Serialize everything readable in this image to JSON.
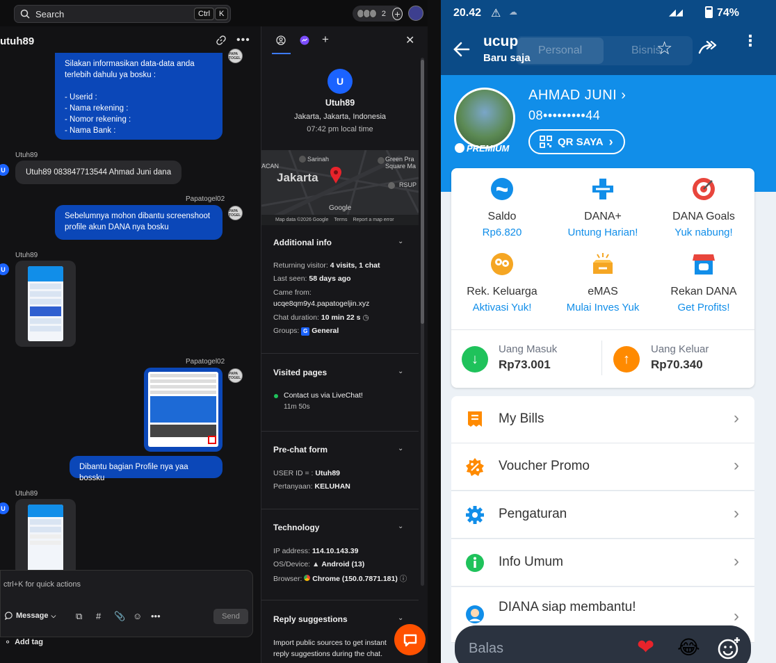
{
  "livechat": {
    "search": {
      "placeholder": "Search",
      "kbd1": "Ctrl",
      "kbd2": "K"
    },
    "top_count": "2",
    "chat_title": "utuh89",
    "messages": {
      "agent_msg1_lines": [
        "Silakan informasikan data-data anda",
        "terlebih dahulu ya bosku :",
        "",
        "- Userid :",
        "- Nama rekening :",
        "- Nomor rekening :",
        "- Nama Bank :"
      ],
      "cust_name": "Utuh89",
      "cust_msg1": "Utuh89 083847713544 Ahmad Juni dana",
      "agent_name": "Papatogel02",
      "agent_msg2": "Sebelumnya mohon dibantu screenshoot profile akun DANA nya bosku",
      "agent_msg3": "Dibantu bagian Profile nya yaa bossku",
      "avatar_letter": "U",
      "agent_avatar_text": "PAPA TOGEL"
    },
    "composer": {
      "placeholder": "ctrl+K for quick actions",
      "mode": "Message",
      "send": "Send",
      "add_tag": "Add tag"
    },
    "details": {
      "avatar_letter": "U",
      "name": "Utuh89",
      "location": "Jakarta, Jakarta, Indonesia",
      "local_time": "07:42 pm local time",
      "map": {
        "city": "Jakarta",
        "sarinah": "Sarinah",
        "acan": "ACAN",
        "green": "Green Pra",
        "green2": "Square Ma",
        "rsup": "RSUP",
        "google": "Google",
        "footer_data": "Map data ©2026 Google",
        "footer_terms": "Terms",
        "footer_report": "Report a map error"
      },
      "additional_title": "Additional info",
      "returning_label": "Returning visitor:",
      "returning_value": "4 visits, 1 chat",
      "last_seen_label": "Last seen:",
      "last_seen_value": "58 days ago",
      "came_from_label": "Came from:",
      "came_from_value": "ucqe8qm9y4.papatogeljin.xyz",
      "duration_label": "Chat duration:",
      "duration_value": "10 min 22 s",
      "groups_label": "Groups:",
      "groups_badge": "G",
      "groups_value": "General",
      "visited_title": "Visited pages",
      "visited_page": "Contact us via LiveChat!",
      "visited_time": "11m 50s",
      "prechat_title": "Pre-chat form",
      "userid_label": "USER ID = :",
      "userid_value": "Utuh89",
      "pertanyaan_label": "Pertanyaan:",
      "pertanyaan_value": "KELUHAN",
      "tech_title": "Technology",
      "ip_label": "IP address:",
      "ip_value": "114.10.143.39",
      "os_label": "OS/Device:",
      "os_value": "Android (13)",
      "browser_label": "Browser:",
      "browser_value": "Chrome (150.0.7871.181)",
      "reply_title": "Reply suggestions",
      "reply_text1": "Import public sources to get instant",
      "reply_text2": "reply suggestions during the chat."
    }
  },
  "phone": {
    "status": {
      "time": "20.42",
      "battery": "74%"
    },
    "appbar": {
      "title": "ucup",
      "subtitle": "Baru saja",
      "tab_personal": "Personal",
      "tab_bisnis": "Bisnis"
    },
    "profile": {
      "name": "AHMAD JUNI",
      "phone": "08•••••••••44",
      "qr_label": "QR SAYA",
      "premium": "PREMIUM"
    },
    "grid": [
      {
        "label": "Saldo",
        "sub": "Rp6.820"
      },
      {
        "label": "DANA+",
        "sub": "Untung Harian!"
      },
      {
        "label": "DANA Goals",
        "sub": "Yuk nabung!"
      },
      {
        "label": "Rek. Keluarga",
        "sub": "Aktivasi Yuk!"
      },
      {
        "label": "eMAS",
        "sub": "Mulai Inves Yuk"
      },
      {
        "label": "Rekan DANA",
        "sub": "Get Profits!"
      }
    ],
    "money": {
      "in_label": "Uang Masuk",
      "in_value": "Rp73.001",
      "out_label": "Uang Keluar",
      "out_value": "Rp70.340"
    },
    "rows": [
      {
        "label": "My Bills"
      },
      {
        "label": "Voucher Promo"
      },
      {
        "label": "Pengaturan"
      },
      {
        "label": "Info Umum"
      },
      {
        "label": "DIANA siap membantu!"
      }
    ],
    "reply": {
      "placeholder": "Balas"
    },
    "colors": {
      "dana_blue": "#118ee9",
      "dana_dark": "#0b4b87",
      "in_green": "#1fc25b",
      "out_orange": "#ff8a00"
    }
  }
}
